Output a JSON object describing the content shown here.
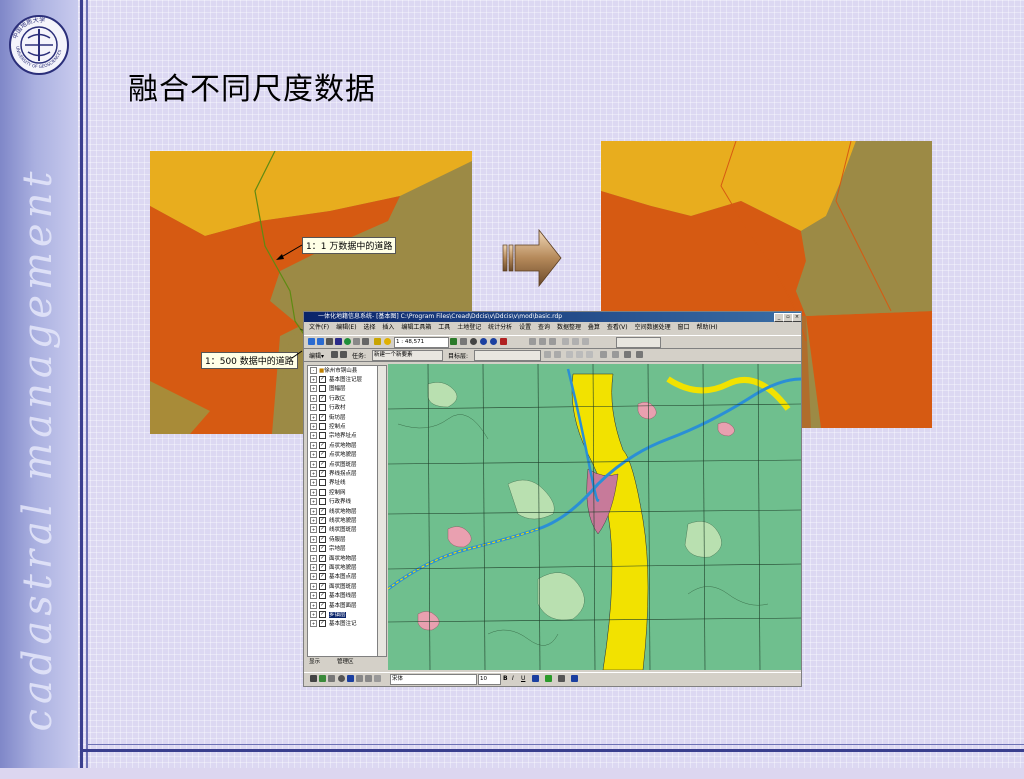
{
  "slide": {
    "title": "融合不同尺度数据",
    "side_text": "cadastral management",
    "logo_text": "中国地质大学 CHINA UNIVERSITY OF GEOSCIENCES",
    "colors": {
      "background": "#dcd8f2",
      "sidebar": "#9aa0d8",
      "rule": "#3a3f8e"
    }
  },
  "map_left": {
    "callout_1": "1：1 万数据中的道路",
    "callout_2": "1：500 数据中的道路",
    "colors": {
      "yellow": "#e8ad1e",
      "orange": "#d65a12",
      "olive": "#9c8a45",
      "road": "#6a8a1e"
    }
  },
  "arrow": {
    "icon": "right-arrow-icon",
    "color": "#b5895a"
  },
  "gis": {
    "title": "一体化地籍信息系统- [基本图] C:\\Program Files\\Cread\\Ddcis\\v\\Ddcis\\v\\mod\\basic.rdp",
    "window_buttons": [
      "_",
      "▫",
      "×"
    ],
    "menu": [
      "文件(F)",
      "编辑(E)",
      "选择",
      "插入",
      "编辑工具箱",
      "工具",
      "土地登记",
      "统计分析",
      "设置",
      "查询",
      "数据整理",
      "叠算",
      "查看(V)",
      "空间数据处理",
      "窗口",
      "帮助(H)"
    ],
    "scale": "1 : 48,571",
    "edit_label": "编辑▾",
    "task_label": "任务:",
    "task_value": "新建一个新要素",
    "target_label": "目标层:",
    "toc_root": "徐州市铜山县",
    "toc_layers": [
      {
        "name": "基本图注记层",
        "checked": true
      },
      {
        "name": "图幅层",
        "checked": false
      },
      {
        "name": "行政区",
        "checked": true
      },
      {
        "name": "行政村",
        "checked": false
      },
      {
        "name": "街坊层",
        "checked": true
      },
      {
        "name": "控制点",
        "checked": false
      },
      {
        "name": "宗地界址点",
        "checked": false
      },
      {
        "name": "点状地物层",
        "checked": true
      },
      {
        "name": "点状地貌层",
        "checked": true
      },
      {
        "name": "点状图斑层",
        "checked": true
      },
      {
        "name": "界线拐点层",
        "checked": true
      },
      {
        "name": "界址线",
        "checked": false
      },
      {
        "name": "控制网",
        "checked": false
      },
      {
        "name": "行政界线",
        "checked": false
      },
      {
        "name": "线状地物层",
        "checked": true
      },
      {
        "name": "线状地貌层",
        "checked": true
      },
      {
        "name": "线状图斑层",
        "checked": true
      },
      {
        "name": "侍服层",
        "checked": true
      },
      {
        "name": "宗地层",
        "checked": true
      },
      {
        "name": "面状地物层",
        "checked": true
      },
      {
        "name": "面状地貌层",
        "checked": true
      },
      {
        "name": "基本图点层",
        "checked": true
      },
      {
        "name": "面状图斑层",
        "checked": true
      },
      {
        "name": "基本图线层",
        "checked": true
      },
      {
        "name": "基本图面层",
        "checked": true
      },
      {
        "name": "乡镇层",
        "checked": true
      },
      {
        "name": "基本图注记",
        "checked": true
      }
    ],
    "toc_tabs": [
      "显示",
      "管理区"
    ],
    "font_name": "宋体",
    "font_size": "10",
    "format_buttons": [
      "B",
      "I",
      "U"
    ],
    "map_colors": {
      "base": "#6fbf8e",
      "river": "#2a8fd6",
      "urban": "#f2e200",
      "pink": "#e9a0b0",
      "light": "#b9e0b0",
      "grid": "#1f3f2a"
    }
  }
}
